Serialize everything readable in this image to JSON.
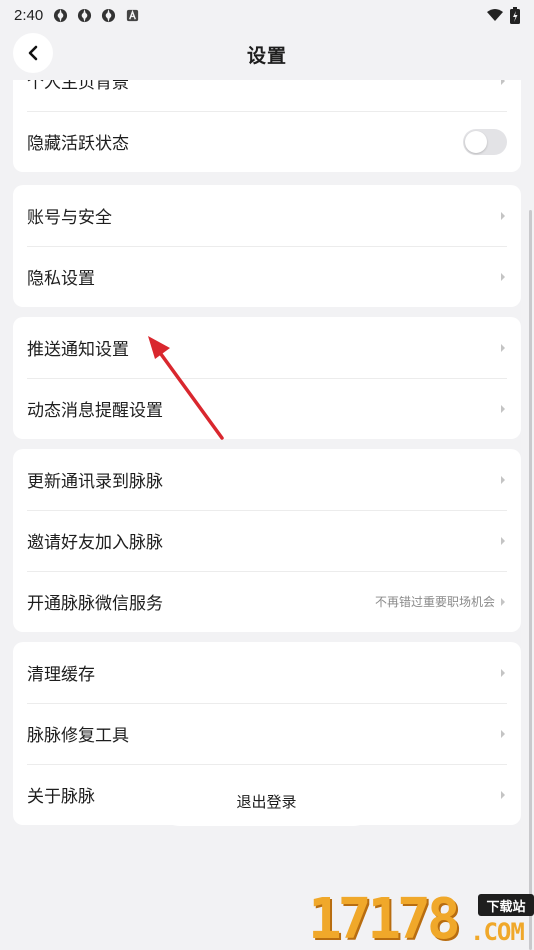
{
  "status_bar": {
    "time": "2:40",
    "icons": [
      "app-notification-icon",
      "app-notification-icon",
      "app-notification-icon",
      "a-notification-icon"
    ],
    "right_icons": [
      "wifi-icon",
      "battery-icon"
    ]
  },
  "header": {
    "title": "设置",
    "back_icon": "chevron-left-icon"
  },
  "groups": [
    {
      "items": [
        {
          "label": "个人主页背景",
          "control": "chevron"
        },
        {
          "label": "隐藏活跃状态",
          "control": "toggle",
          "toggle_on": false
        }
      ]
    },
    {
      "items": [
        {
          "label": "账号与安全",
          "control": "chevron"
        },
        {
          "label": "隐私设置",
          "control": "chevron"
        }
      ]
    },
    {
      "items": [
        {
          "label": "推送通知设置",
          "control": "chevron"
        },
        {
          "label": "动态消息提醒设置",
          "control": "chevron"
        }
      ]
    },
    {
      "items": [
        {
          "label": "更新通讯录到脉脉",
          "control": "chevron"
        },
        {
          "label": "邀请好友加入脉脉",
          "control": "chevron"
        },
        {
          "label": "开通脉脉微信服务",
          "hint": "不再错过重要职场机会",
          "control": "chevron"
        }
      ]
    },
    {
      "items": [
        {
          "label": "清理缓存",
          "control": "chevron"
        },
        {
          "label": "脉脉修复工具",
          "control": "chevron"
        },
        {
          "label": "关于脉脉",
          "control": "chevron"
        }
      ]
    }
  ],
  "logout_label": "退出登录",
  "annotation": {
    "color": "#d9272e",
    "points_to": "推送通知设置"
  },
  "watermark": {
    "digits": "17178",
    "badge": "下载站",
    "domain": ".COM"
  },
  "colors": {
    "background": "#f2f2f4",
    "card": "#ffffff",
    "toggle_off": "#e3e3e6",
    "watermark": "#f0a82a"
  }
}
